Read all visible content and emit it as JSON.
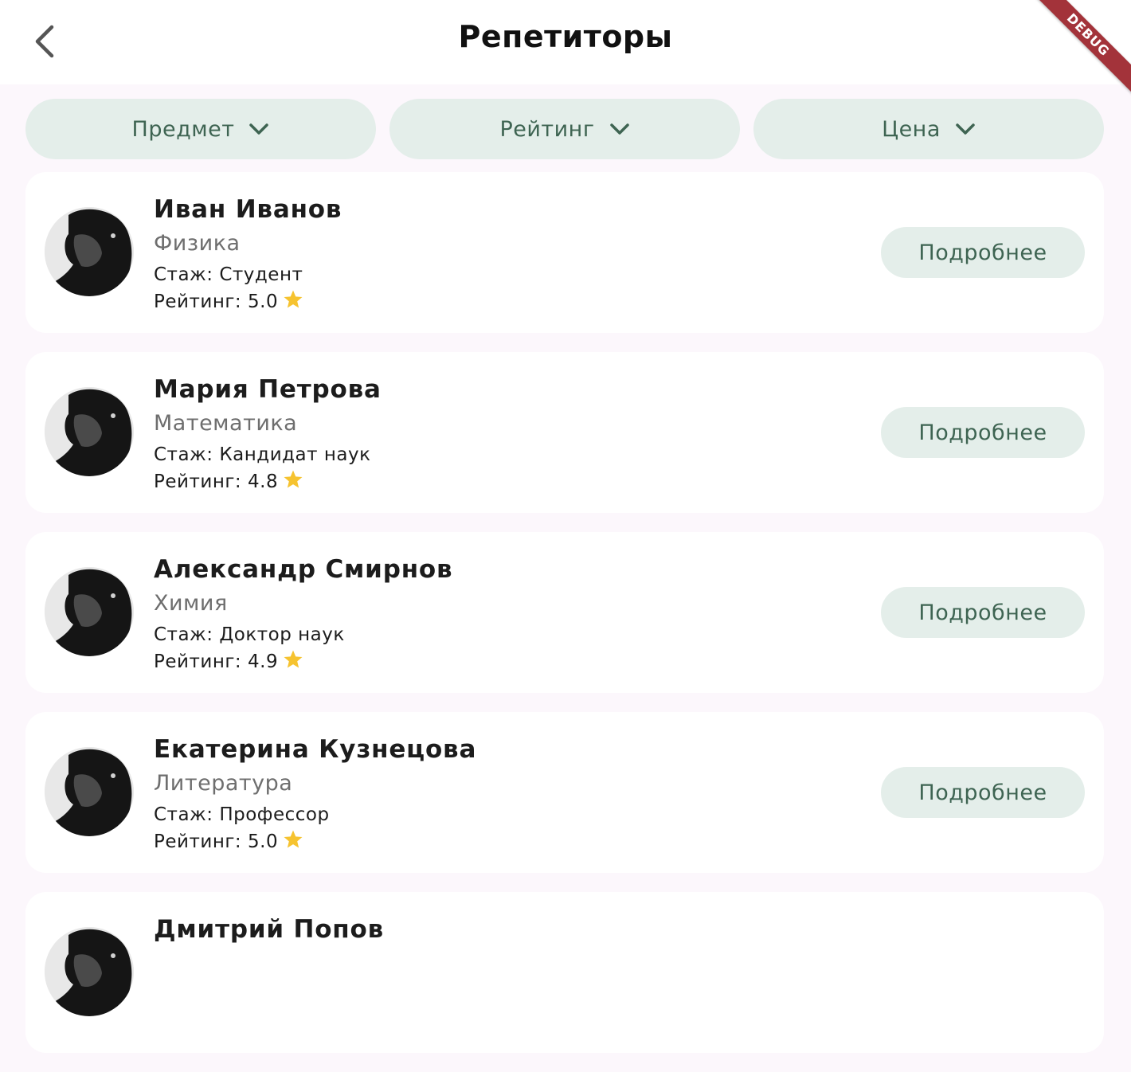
{
  "appbar": {
    "title": "Репетиторы",
    "debug_label": "DEBUG"
  },
  "filters": [
    {
      "label": "Предмет"
    },
    {
      "label": "Рейтинг"
    },
    {
      "label": "Цена"
    }
  ],
  "tutors": [
    {
      "name": "Иван Иванов",
      "subject": "Физика",
      "experience": "Стаж: Студент",
      "rating": "Рейтинг: 5.0",
      "button": "Подробнее"
    },
    {
      "name": "Мария Петрова",
      "subject": "Математика",
      "experience": "Стаж: Кандидат наук",
      "rating": "Рейтинг: 4.8",
      "button": "Подробнее"
    },
    {
      "name": "Александр Смирнов",
      "subject": "Химия",
      "experience": "Стаж: Доктор наук",
      "rating": "Рейтинг: 4.9",
      "button": "Подробнее"
    },
    {
      "name": "Екатерина Кузнецова",
      "subject": "Литература",
      "experience": "Стаж: Профессор",
      "rating": "Рейтинг: 5.0",
      "button": "Подробнее"
    },
    {
      "name": "Дмитрий Попов"
    }
  ],
  "colors": {
    "background": "#fcf7fc",
    "chip_bg": "#e4eeea",
    "chip_text": "#3e6452",
    "star": "#f6c330",
    "debug_ribbon": "#a3333a"
  },
  "icons": {
    "back": "chevron-left-icon",
    "dropdown": "chevron-down-icon",
    "rating": "star-icon"
  }
}
